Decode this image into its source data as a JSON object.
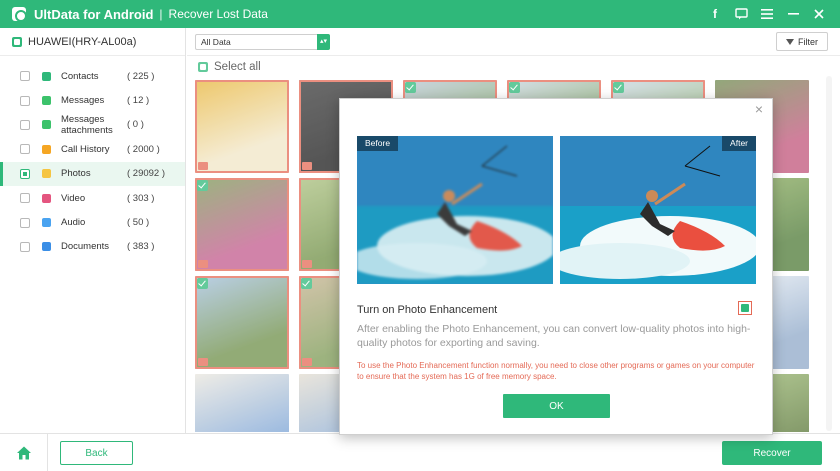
{
  "titlebar": {
    "app_name": "UltData for Android",
    "separator": "|",
    "page_title": "Recover Lost Data",
    "icons": [
      "facebook-icon",
      "feedback-icon",
      "menu-icon",
      "minimize-icon",
      "close-icon"
    ]
  },
  "device": {
    "name": "HUAWEI(HRY-AL00a)"
  },
  "categories": [
    {
      "label": "Contacts",
      "count": "( 225 )",
      "icon": "contacts-icon",
      "color": "#2fb87a"
    },
    {
      "label": "Messages",
      "count": "( 12 )",
      "icon": "messages-icon",
      "color": "#3cc26b"
    },
    {
      "label": "Messages attachments",
      "count": "( 0 )",
      "icon": "attachment-icon",
      "color": "#3cc26b"
    },
    {
      "label": "Call History",
      "count": "( 2000 )",
      "icon": "call-history-icon",
      "color": "#f5a623"
    },
    {
      "label": "Photos",
      "count": "( 29092 )",
      "icon": "photos-icon",
      "color": "#f5c542"
    },
    {
      "label": "Video",
      "count": "( 303 )",
      "icon": "video-icon",
      "color": "#e4557f"
    },
    {
      "label": "Audio",
      "count": "( 50 )",
      "icon": "audio-icon",
      "color": "#4aa3f0"
    },
    {
      "label": "Documents",
      "count": "( 383 )",
      "icon": "documents-icon",
      "color": "#3a8ee6"
    }
  ],
  "toolbar": {
    "filter_select": "All Data",
    "filter_button": "Filter"
  },
  "select_all": "Select all",
  "bottom": {
    "back": "Back",
    "recover": "Recover"
  },
  "modal": {
    "before_label": "Before",
    "after_label": "After",
    "title": "Turn on Photo Enhancement",
    "description": "After enabling the Photo Enhancement, you can convert low-quality photos into high-quality photos for exporting and saving.",
    "warning": "To use the Photo Enhancement function normally, you need to close other programs or games on your computer to ensure that the system has 1G of free memory space.",
    "ok": "OK",
    "enhancement_checked": true
  }
}
